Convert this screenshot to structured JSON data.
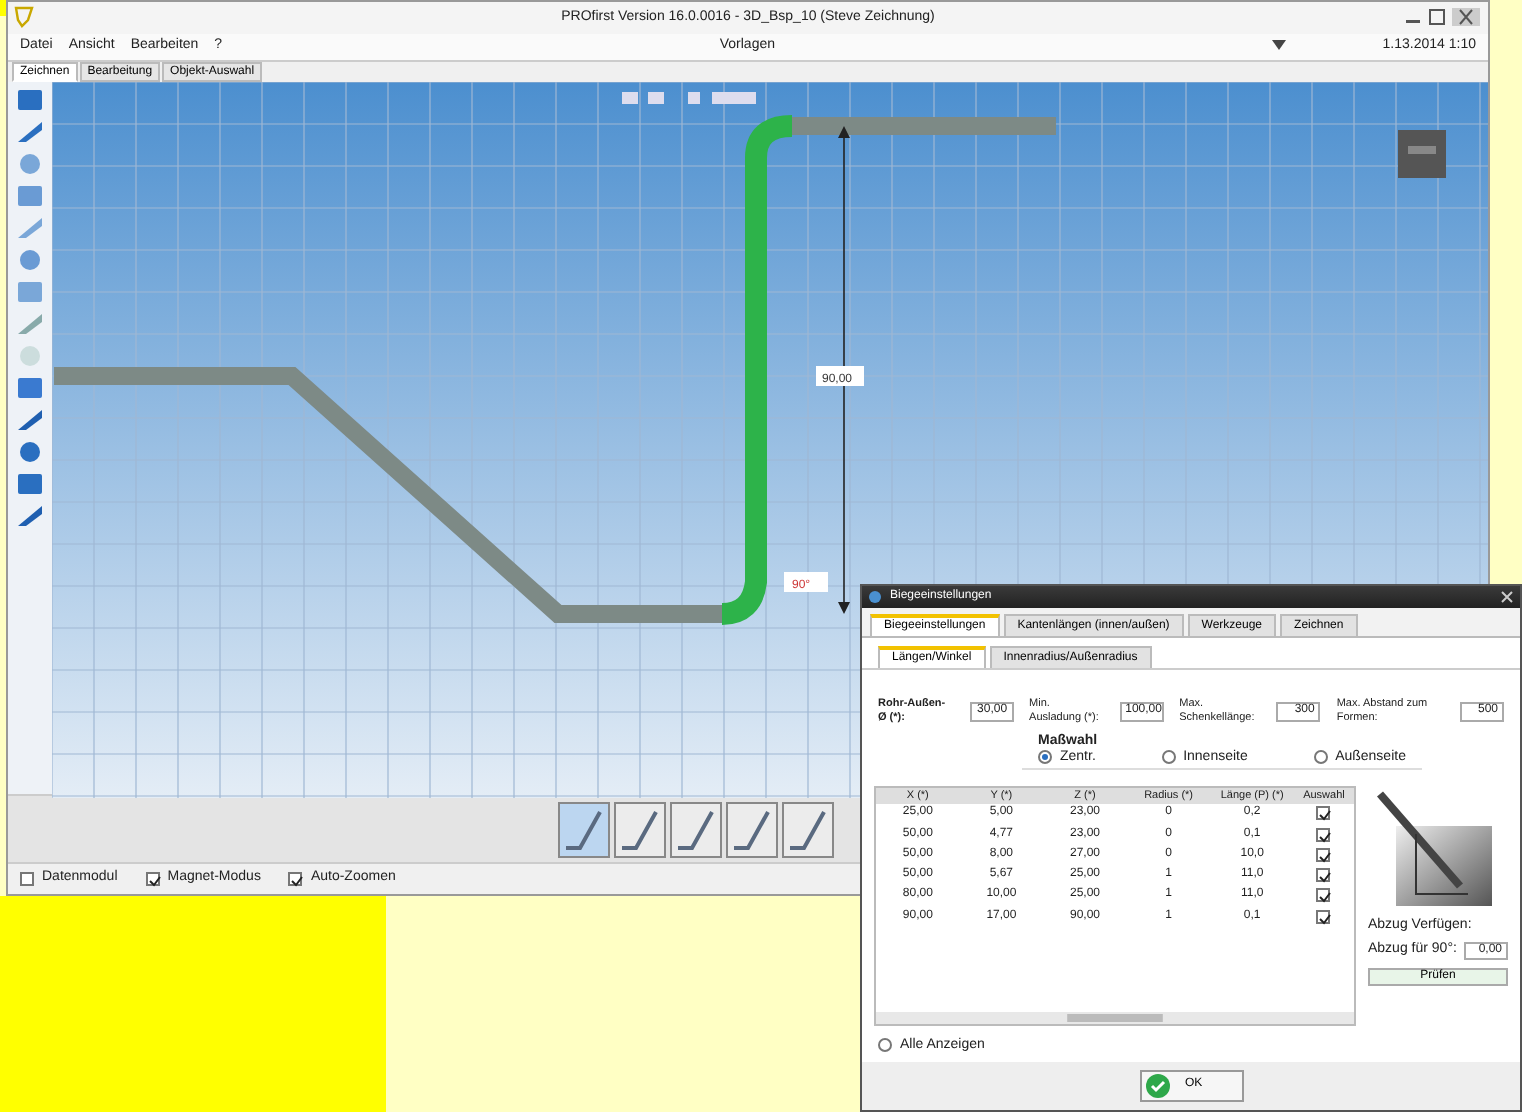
{
  "window": {
    "title": "PROfirst Version 16.0.0016 - 3D_Bsp_10 (Steve Zeichnung)"
  },
  "menu": [
    {
      "label": "Datei"
    },
    {
      "label": "Ansicht"
    },
    {
      "label": "Bearbeiten"
    },
    {
      "label": "?"
    }
  ],
  "toolbar": {
    "center_label": "Vorlagen",
    "right_label": "1.13.2014 1:10"
  },
  "tabs": [
    {
      "label": "Zeichnen",
      "selected": true
    },
    {
      "label": "Bearbeitung",
      "selected": false
    },
    {
      "label": "Objekt-Auswahl",
      "selected": false
    }
  ],
  "canvas": {
    "length_label": "90,00",
    "angle_label": "90°"
  },
  "bend_shapes": [
    {
      "selected": true
    },
    {
      "selected": false
    },
    {
      "selected": false
    },
    {
      "selected": false
    },
    {
      "selected": false
    }
  ],
  "status_bar": [
    {
      "label": "Datenmodul",
      "checked": false
    },
    {
      "label": "Magnet-Modus",
      "checked": true
    },
    {
      "label": "Auto-Zoomen",
      "checked": true
    }
  ],
  "dialog": {
    "title": "Biegeeinstellungen",
    "tabs": [
      {
        "label": "Biegeeinstellungen",
        "selected": true
      },
      {
        "label": "Kantenlängen (innen/außen)",
        "selected": false
      },
      {
        "label": "Werkzeuge",
        "selected": false
      },
      {
        "label": "Zeichnen",
        "selected": false
      }
    ],
    "subtabs": [
      {
        "label": "Längen/Winkel",
        "selected": true
      },
      {
        "label": "Innenradius/Außenradius",
        "selected": false
      }
    ],
    "fields": [
      {
        "label": "Rohr-Außen-Ø (*):",
        "value": "30,00"
      },
      {
        "label": "Min. Ausladung (*):",
        "value": "100,00"
      },
      {
        "label": "Max. Schenkellänge:",
        "value": "300"
      },
      {
        "label": "Max. Abstand zum Formen:",
        "value": "500"
      }
    ],
    "radio_group": {
      "label": "Maßwahl",
      "options": [
        {
          "label": "Zentr.",
          "selected": true
        },
        {
          "label": "Innenseite",
          "selected": false
        },
        {
          "label": "Außenseite",
          "selected": false
        }
      ]
    },
    "columns": [
      "X (*)",
      "Y (*)",
      "Z (*)",
      "Radius (*)",
      "Länge (P) (*)",
      "Auswahl"
    ],
    "rows": [
      {
        "cells": [
          "25,00",
          "5,00",
          "23,00",
          "0",
          "0,2"
        ],
        "checked": true
      },
      {
        "cells": [
          "50,00",
          "4,77",
          "23,00",
          "0",
          "0,1"
        ],
        "checked": true
      },
      {
        "cells": [
          "50,00",
          "8,00",
          "27,00",
          "0",
          "10,0"
        ],
        "checked": true
      },
      {
        "cells": [
          "50,00",
          "5,67",
          "25,00",
          "1",
          "11,0"
        ],
        "checked": true
      },
      {
        "cells": [
          "80,00",
          "10,00",
          "25,00",
          "1",
          "11,0"
        ],
        "checked": true
      },
      {
        "cells": [
          "90,00",
          "17,00",
          "90,00",
          "1",
          "0,1"
        ],
        "checked": true
      }
    ],
    "side": {
      "label": "Abzug Verfügen:",
      "field_label": "Abzug für 90°:",
      "field_value": "0,00",
      "button": "Prüfen"
    },
    "show_all": {
      "label": "Alle Anzeigen",
      "checked": false
    },
    "ok": "OK"
  }
}
